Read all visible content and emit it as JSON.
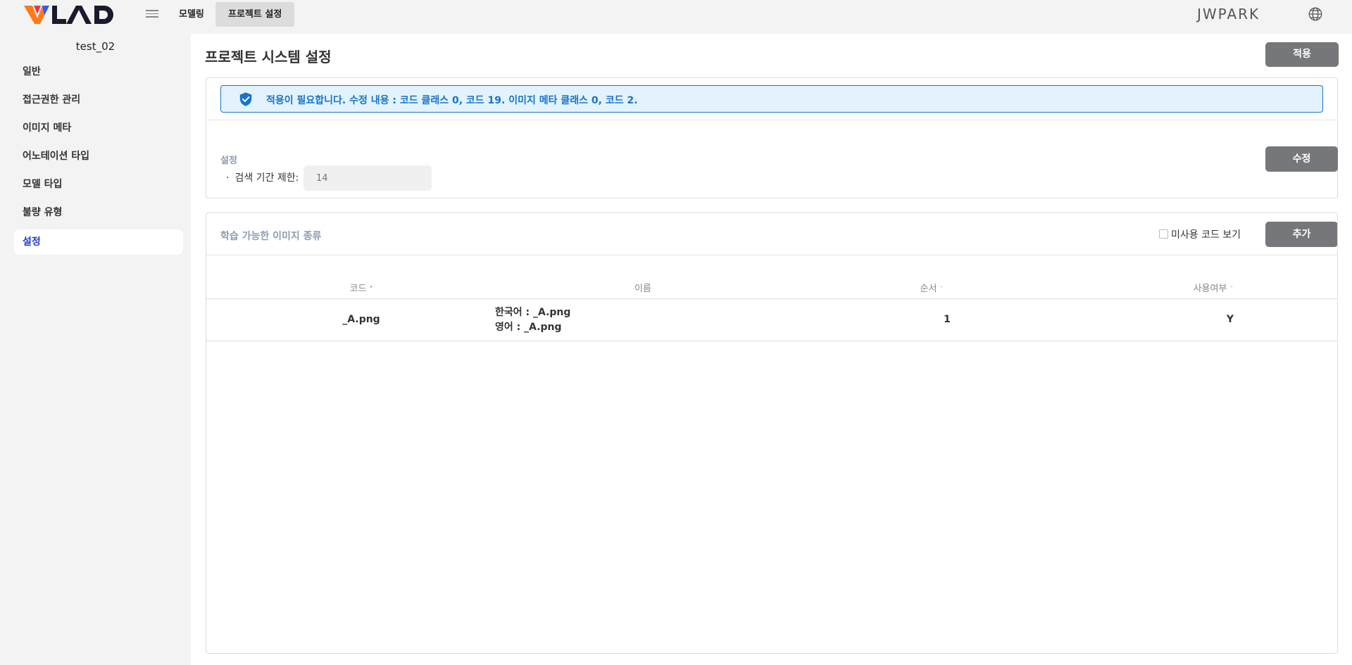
{
  "header": {
    "logo_text": "VLAD",
    "nav": [
      {
        "label": "모델링"
      },
      {
        "label": "프로젝트 설정"
      }
    ],
    "user": "JWPARK",
    "colors": {
      "logo_dark": "#1a1a2e",
      "logo_orange": "#ff7a1a",
      "logo_blue": "#2b5cff",
      "logo_red": "#e8324a"
    }
  },
  "sidebar": {
    "project_name": "test_02",
    "items": [
      {
        "label": "일반"
      },
      {
        "label": "접근권한 관리"
      },
      {
        "label": "이미지 메타"
      },
      {
        "label": "어노테이션 타입"
      },
      {
        "label": "모델 타입"
      },
      {
        "label": "불량 유형"
      },
      {
        "label": "설정",
        "active": true
      }
    ]
  },
  "main": {
    "title": "프로젝트 시스템 설정",
    "apply_label": "적용",
    "alert_text": "적용이 필요합니다. 수정 내용 : 코드 클래스 0, 코드 19. 이미지 메타 클래스 0, 코드 2.",
    "settings": {
      "label": "설정",
      "bullet": "·",
      "field_label": "검색 기간 제한:",
      "field_placeholder": "14",
      "edit_label": "수정"
    },
    "image_types": {
      "title": "학습 가능한 이미지 종류",
      "unused_label": "미사용 코드 보기",
      "add_label": "추가",
      "columns": [
        {
          "label": "코드",
          "sort": "˅"
        },
        {
          "label": "이름"
        },
        {
          "label": "순서",
          "sort": "˅"
        },
        {
          "label": "사용여부",
          "sort": "˅"
        }
      ],
      "rows": [
        {
          "code": "_A.png",
          "name_ko": "한국어 : _A.png",
          "name_en": "영어 : _A.png",
          "order": "1",
          "use": "Y"
        }
      ]
    }
  }
}
